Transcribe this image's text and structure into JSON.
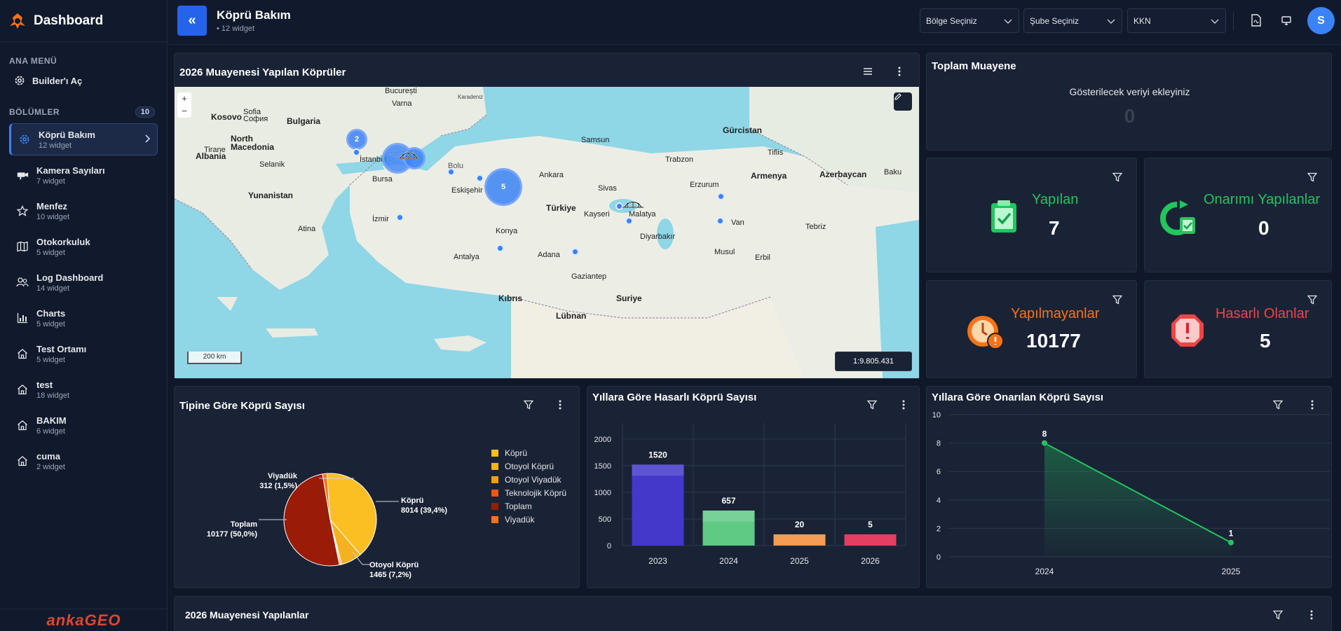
{
  "sidebar": {
    "brand": "Dashboard",
    "main_menu_label": "ANA MENÜ",
    "builder_label": "Builder'ı Aç",
    "sections_label": "BÖLÜMLER",
    "sections_count": "10",
    "items": [
      {
        "label": "Köprü Bakım",
        "sub": "12 widget"
      },
      {
        "label": "Kamera Sayıları",
        "sub": "7 widget"
      },
      {
        "label": "Menfez",
        "sub": "10 widget"
      },
      {
        "label": "Otokorkuluk",
        "sub": "5 widget"
      },
      {
        "label": "Log Dashboard",
        "sub": "14 widget"
      },
      {
        "label": "Charts",
        "sub": "5 widget"
      },
      {
        "label": "Test Ortamı",
        "sub": "5 widget"
      },
      {
        "label": "test",
        "sub": "18 widget"
      },
      {
        "label": "BAKIM",
        "sub": "6 widget"
      },
      {
        "label": "cuma",
        "sub": "2 widget"
      }
    ],
    "footer_logo": "ankaGEO"
  },
  "header": {
    "back_label": "«",
    "title": "Köprü Bakım",
    "subtitle": "• 12 widget",
    "region_select": "Bölge Seçiniz",
    "branch_select": "Şube Seçiniz",
    "kkn_select": "KKN",
    "avatar": "S"
  },
  "map_panel": {
    "title": "2026 Muayenesi Yapılan Köprüler",
    "scale": "200 km",
    "ratio": "1:9.805.431",
    "clusters": [
      "2",
      "5"
    ],
    "labels": {
      "karadeniz": "Karadeniz",
      "bulgaria": "Bulgaria",
      "sofia": "Sofia",
      "sofia_native": "София",
      "kosovo": "Kosovo",
      "north_macedonia": "North\nMacedonia",
      "albania": "Albania",
      "tirane": "Tirane",
      "selanik": "Selanik",
      "yunanistan": "Yunanistan",
      "atina": "Atina",
      "bucuresti": "București",
      "varna": "Varna",
      "bursa": "Bursa",
      "istanbul": "İstanbul",
      "eskisehir": "Eskişehir",
      "ankara": "Ankara",
      "turkiye": "Türkiye",
      "konya": "Konya",
      "izmir": "İzmir",
      "antalya": "Antalya",
      "adana": "Adana",
      "kibris": "Kıbrıs",
      "suriye": "Suriye",
      "lubnan": "Lübnan",
      "gurcistan": "Gürcistan",
      "tiflis": "Tiflis",
      "armenia": "Armenya",
      "azerbaycan": "Azerbaycan",
      "baku": "Baku",
      "erzurum": "Erzurum",
      "sivas": "Sivas",
      "kayseri": "Kayseri",
      "van": "Van",
      "tebriz": "Tebriz",
      "erbil": "Erbil",
      "musul": "Musul",
      "gaziantep": "Gaziantep",
      "diyarbakir": "Diyarbakır",
      "samsun": "Samsun",
      "trabzon": "Trabzon",
      "malatya": "Malatya"
    }
  },
  "total_panel": {
    "title": "Toplam Muayene",
    "message": "Gösterilecek veriyi ekleyiniz",
    "value": "0"
  },
  "stats": [
    {
      "label": "Yapılan",
      "value": "7",
      "color": "#22c55e"
    },
    {
      "label": "Onarımı Yapılanlar",
      "value": "0",
      "color": "#22c55e"
    },
    {
      "label": "Yapılmayanlar",
      "value": "10177",
      "color": "#f97316"
    },
    {
      "label": "Hasarlı Olanlar",
      "value": "5",
      "color": "#ef4444"
    }
  ],
  "pie_panel": {
    "title": "Tipine Göre Köprü Sayısı",
    "legend": [
      "Köprü",
      "Otoyol Köprü",
      "Otoyol Viyadük",
      "Teknolojik Köprü",
      "Toplam",
      "Viyadük"
    ],
    "callouts": {
      "kopru": "Köprü",
      "kopru_val": "8014 (39,4%)",
      "otoyol": "Otoyol Köprü",
      "otoyol_val": "1465 (7,2%)",
      "toplam": "Toplam",
      "toplam_val": "10177 (50,0%)",
      "viyaduk": "Viyadük",
      "viyaduk_val": "312 (1,5%)"
    }
  },
  "bar_panel": {
    "title": "Yıllara Göre Hasarlı Köprü Sayısı"
  },
  "line_panel": {
    "title": "Yıllara Göre Onarılan Köprü Sayısı"
  },
  "bottom_panel": {
    "title": "2026 Muayenesi Yapılanlar"
  },
  "colors": {
    "accent": "#2563eb",
    "bg": "#0f1729",
    "panel": "#1a2335"
  },
  "chart_data": [
    {
      "type": "pie",
      "title": "Tipine Göre Köprü Sayısı",
      "categories": [
        "Köprü",
        "Otoyol Köprü",
        "Otoyol Viyadük",
        "Teknolojik Köprü",
        "Toplam",
        "Viyadük"
      ],
      "values": [
        8014,
        1465,
        90,
        80,
        10177,
        312
      ],
      "colors": [
        "#fbbf24",
        "#f5b11e",
        "#f59e0b",
        "#ea580c",
        "#9a1b06",
        "#f97316"
      ]
    },
    {
      "type": "bar",
      "title": "Yıllara Göre Hasarlı Köprü Sayısı",
      "categories": [
        "2023",
        "2024",
        "2025",
        "2026"
      ],
      "values": [
        1520,
        657,
        20,
        5
      ],
      "colors": [
        "#4338ca",
        "#5eca84",
        "#f28c38",
        "#e11d48"
      ],
      "yticks": [
        0,
        500,
        1000,
        1500,
        2000
      ],
      "ylim": [
        0,
        2300
      ]
    },
    {
      "type": "line",
      "title": "Yıllara Göre Onarılan Köprü Sayısı",
      "categories": [
        "2024",
        "2025"
      ],
      "values": [
        8,
        1
      ],
      "yticks": [
        0,
        2,
        4,
        6,
        8,
        10
      ],
      "ylim": [
        0,
        10
      ]
    }
  ]
}
